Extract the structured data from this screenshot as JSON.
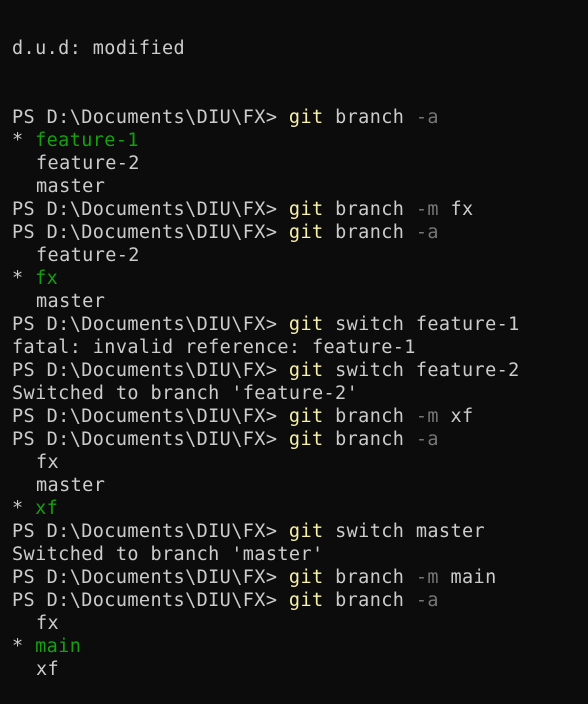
{
  "terminal": {
    "prompt": "PS D:\\Documents\\DIU\\FX> ",
    "truncated_top": "d.u.d: modified",
    "colors": {
      "background": "#0c0c0c",
      "text": "#cccccc",
      "command": "#f9f1a5",
      "parameter": "#767676",
      "current_branch": "#13a10e"
    },
    "lines": [
      {
        "kind": "prompt",
        "cmd": "git",
        "rest": " branch ",
        "param": "-a",
        "tail": ""
      },
      {
        "kind": "current",
        "star": "* ",
        "name": "feature-1"
      },
      {
        "kind": "branch",
        "name": "feature-2"
      },
      {
        "kind": "branch",
        "name": "master"
      },
      {
        "kind": "prompt",
        "cmd": "git",
        "rest": " branch ",
        "param": "-m",
        "tail": " fx"
      },
      {
        "kind": "prompt",
        "cmd": "git",
        "rest": " branch ",
        "param": "-a",
        "tail": ""
      },
      {
        "kind": "branch",
        "name": "feature-2"
      },
      {
        "kind": "current",
        "star": "* ",
        "name": "fx"
      },
      {
        "kind": "branch",
        "name": "master"
      },
      {
        "kind": "prompt",
        "cmd": "git",
        "rest": " switch feature-1",
        "param": "",
        "tail": ""
      },
      {
        "kind": "output",
        "text": "fatal: invalid reference: feature-1"
      },
      {
        "kind": "prompt",
        "cmd": "git",
        "rest": " switch feature-2",
        "param": "",
        "tail": ""
      },
      {
        "kind": "output",
        "text": "Switched to branch 'feature-2'"
      },
      {
        "kind": "prompt",
        "cmd": "git",
        "rest": " branch ",
        "param": "-m",
        "tail": " xf"
      },
      {
        "kind": "prompt",
        "cmd": "git",
        "rest": " branch ",
        "param": "-a",
        "tail": ""
      },
      {
        "kind": "branch",
        "name": "fx"
      },
      {
        "kind": "branch",
        "name": "master"
      },
      {
        "kind": "current",
        "star": "* ",
        "name": "xf"
      },
      {
        "kind": "prompt",
        "cmd": "git",
        "rest": " switch master",
        "param": "",
        "tail": ""
      },
      {
        "kind": "output",
        "text": "Switched to branch 'master'"
      },
      {
        "kind": "prompt",
        "cmd": "git",
        "rest": " branch ",
        "param": "-m",
        "tail": " main"
      },
      {
        "kind": "prompt",
        "cmd": "git",
        "rest": " branch ",
        "param": "-a",
        "tail": ""
      },
      {
        "kind": "branch",
        "name": "fx"
      },
      {
        "kind": "current",
        "star": "* ",
        "name": "main"
      },
      {
        "kind": "branch",
        "name": "xf"
      }
    ]
  }
}
